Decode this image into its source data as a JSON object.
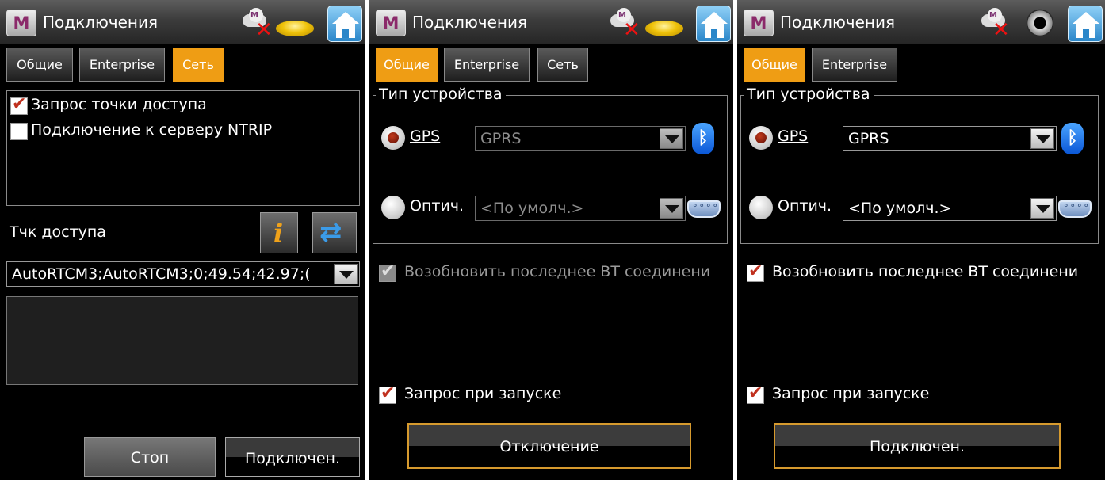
{
  "panels": [
    {
      "title": "Подключения",
      "tabs": [
        "Общие",
        "Enterprise",
        "Сеть"
      ],
      "active_tab": "Сеть",
      "status_icons": [
        "cloud-disconnected-icon",
        "gnss-receiver-icon"
      ],
      "options": [
        {
          "label": "Запрос точки доступа",
          "checked": true
        },
        {
          "label": "Подключение к серверу NTRIP",
          "checked": false
        }
      ],
      "access_point_label": "Тчк доступа",
      "access_point_value": "AutoRTCM3;AutoRTCM3;0;49.54;42.97;(",
      "buttons": {
        "stop": "Стоп",
        "connect": "Подключен."
      }
    },
    {
      "title": "Подключения",
      "tabs": [
        "Общие",
        "Enterprise",
        "Сеть"
      ],
      "active_tab": "Общие",
      "status_icons": [
        "cloud-disconnected-icon",
        "gnss-receiver-icon"
      ],
      "device_type_legend": "Тип устройства",
      "radio_gps": {
        "label": "GPS",
        "selected": true
      },
      "combo_gps": "GPRS",
      "radio_optic": {
        "label": "Оптич.",
        "selected": false
      },
      "combo_optic": "<По умолч.>",
      "resume_bt": {
        "label": "Возобновить последнее ВТ соединени",
        "checked": true,
        "enabled": false
      },
      "ask_on_start": {
        "label": "Запрос при запуске",
        "checked": true
      },
      "action_button": "Отключение"
    },
    {
      "title": "Подключения",
      "tabs": [
        "Общие",
        "Enterprise"
      ],
      "active_tab": "Общие",
      "status_icons": [
        "cloud-disconnected-icon",
        "total-station-icon"
      ],
      "device_type_legend": "Тип устройства",
      "radio_gps": {
        "label": "GPS",
        "selected": true
      },
      "combo_gps": "GPRS",
      "radio_optic": {
        "label": "Оптич.",
        "selected": false
      },
      "combo_optic": "<По умолч.>",
      "resume_bt": {
        "label": "Возобновить последнее ВТ соединени",
        "checked": true,
        "enabled": true
      },
      "ask_on_start": {
        "label": "Запрос при запуске",
        "checked": true
      },
      "action_button": "Подключен."
    }
  ],
  "colors": {
    "active_tab": "#ef9d14",
    "button_border": "#d69a2e",
    "background": "#000000"
  }
}
